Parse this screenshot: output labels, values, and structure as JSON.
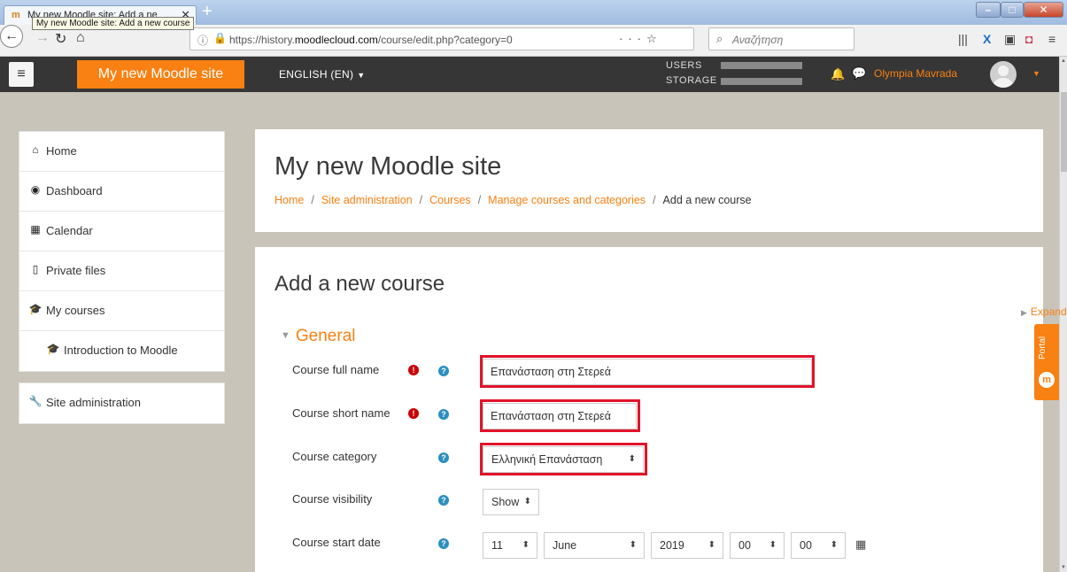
{
  "browser": {
    "tab_title": "My new Moodle site: Add a ne",
    "tab_tooltip": "My new Moodle site: Add a new course",
    "url_prefix": "https://history.",
    "url_domain": "moodlecloud.com",
    "url_path": "/course/edit.php?category=0",
    "search_placeholder": "Αναζήτηση"
  },
  "moodle_nav": {
    "brand": "My new Moodle site",
    "language": "ENGLISH (EN)",
    "quota_users_label": "USERS",
    "quota_storage_label": "STORAGE",
    "user_name": "Olympia Mavrada"
  },
  "sidebar": {
    "items": [
      {
        "label": "Home",
        "icon": "home-icon"
      },
      {
        "label": "Dashboard",
        "icon": "dashboard-icon"
      },
      {
        "label": "Calendar",
        "icon": "calendar-icon"
      },
      {
        "label": "Private files",
        "icon": "file-icon"
      },
      {
        "label": "My courses",
        "icon": "graduation-cap-icon"
      },
      {
        "label": "Introduction to Moodle",
        "icon": "graduation-cap-icon"
      }
    ],
    "admin": {
      "label": "Site administration",
      "icon": "wrench-icon"
    }
  },
  "header": {
    "title": "My new Moodle site",
    "breadcrumb": [
      "Home",
      "Site administration",
      "Courses",
      "Manage courses and categories",
      "Add a new course"
    ]
  },
  "form": {
    "heading": "Add a new course",
    "expand_all": "Expand all",
    "section": "General",
    "fields": {
      "fullname": {
        "label": "Course full name",
        "value": "Επανάσταση στη Στερεά"
      },
      "shortname": {
        "label": "Course short name",
        "value": "Επανάσταση στη Στερεά"
      },
      "category": {
        "label": "Course category",
        "value": "Ελληνική Επανάσταση"
      },
      "visibility": {
        "label": "Course visibility",
        "value": "Show"
      },
      "startdate": {
        "label": "Course start date",
        "day": "11",
        "month": "June",
        "year": "2019",
        "hour": "00",
        "minute": "00"
      }
    }
  },
  "portal": {
    "label": "Portal"
  },
  "colors": {
    "accent": "#f98012",
    "navbar": "#363636",
    "highlight": "#e1132a",
    "help": "#2b8fbf",
    "required": "#cc0000"
  }
}
